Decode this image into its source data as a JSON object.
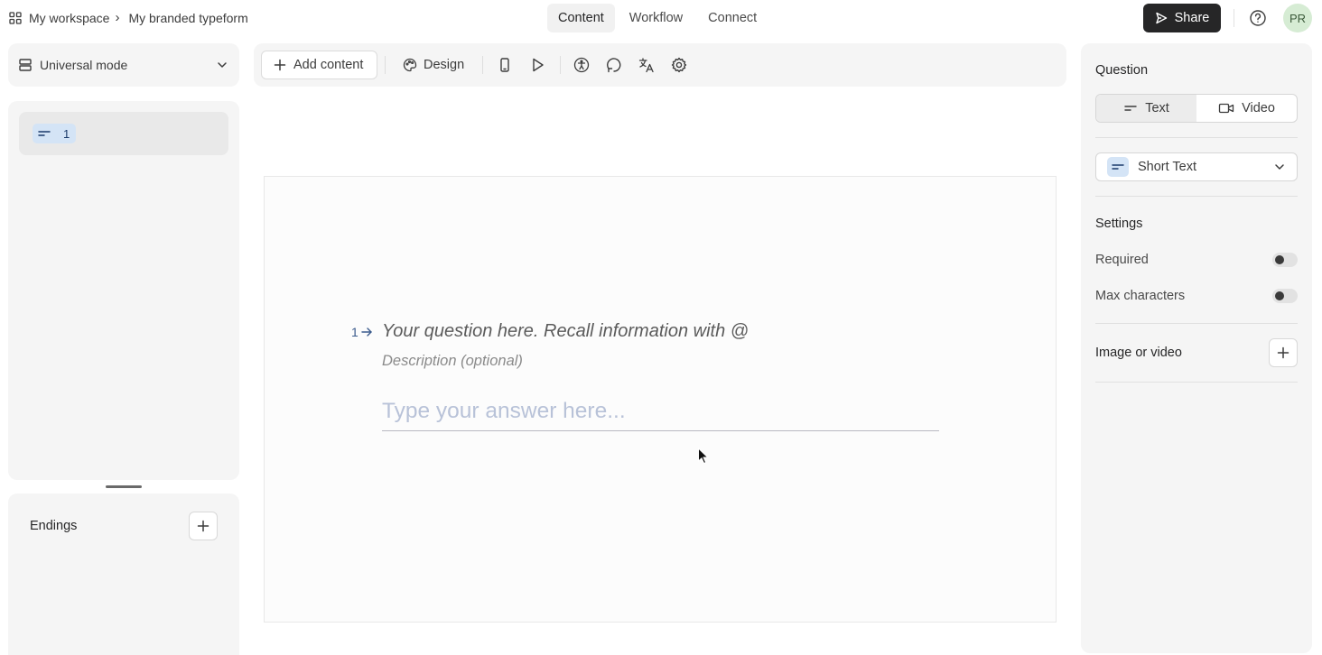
{
  "breadcrumb": {
    "workspace": "My workspace",
    "separator": "›",
    "form": "My branded typeform"
  },
  "nav_tabs": [
    {
      "label": "Content",
      "active": true
    },
    {
      "label": "Workflow",
      "active": false
    },
    {
      "label": "Connect",
      "active": false
    }
  ],
  "header": {
    "share_label": "Share",
    "avatar_initials": "PR"
  },
  "sidebar": {
    "mode_label": "Universal mode",
    "questions": [
      {
        "number": "1",
        "icon": "short-text-icon"
      }
    ],
    "endings_label": "Endings"
  },
  "toolbar": {
    "add_content_label": "Add content",
    "design_label": "Design",
    "icons": [
      "mobile-preview-icon",
      "play-icon",
      "accessibility-icon",
      "logic-icon",
      "translate-icon",
      "settings-icon"
    ]
  },
  "canvas": {
    "question_number": "1",
    "question_placeholder": "Your question here. Recall information with @",
    "description_placeholder": "Description (optional)",
    "answer_placeholder": "Type your answer here..."
  },
  "right_panel": {
    "question_heading": "Question",
    "segment_text": "Text",
    "segment_video": "Video",
    "question_type": "Short Text",
    "settings_heading": "Settings",
    "required_label": "Required",
    "required_on": false,
    "max_chars_label": "Max characters",
    "max_chars_on": false,
    "media_label": "Image or video"
  },
  "colors": {
    "accent_dark": "#262627",
    "question_badge": "#d4e4f6",
    "avatar_bg": "#d6ecd4"
  }
}
